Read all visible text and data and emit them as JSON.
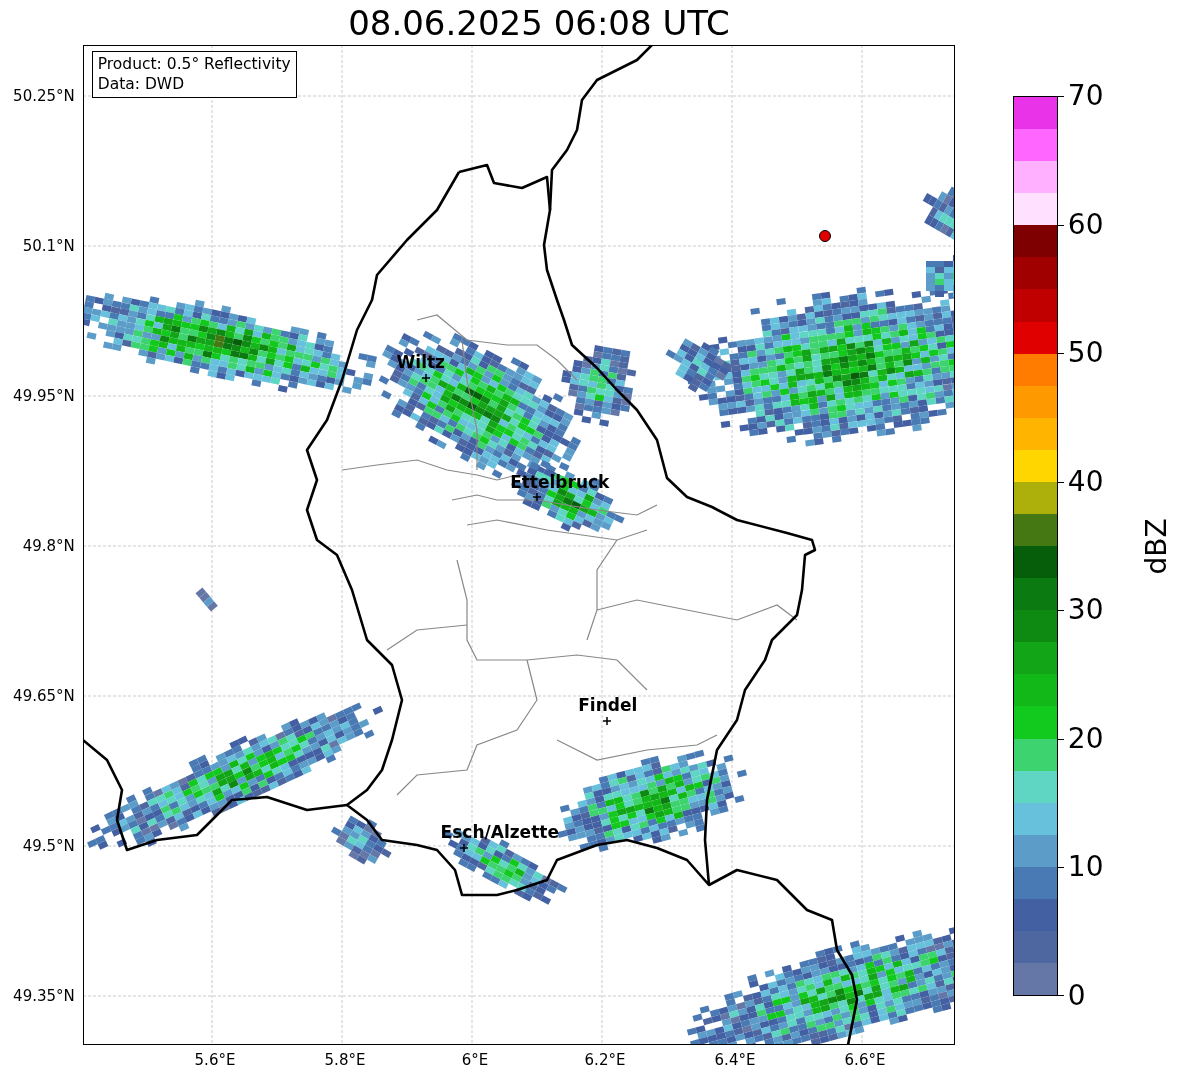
{
  "title": "08.06.2025 06:08 UTC",
  "info_box": [
    "Product: 0.5° Reflectivity",
    "Data: DWD"
  ],
  "map": {
    "lat_ticks": [
      "50.25°N",
      "50.1°N",
      "49.95°N",
      "49.8°N",
      "49.65°N",
      "49.5°N",
      "49.35°N"
    ],
    "lon_ticks": [
      "5.6°E",
      "5.8°E",
      "6°E",
      "6.2°E",
      "6.4°E",
      "6.6°E"
    ],
    "places": [
      {
        "name": "Wiltz"
      },
      {
        "name": "Ettelbruck"
      },
      {
        "name": "Findel"
      },
      {
        "name": "Esch/Alzette"
      }
    ]
  },
  "colorbar": {
    "label": "dBZ",
    "ticks": [
      "70",
      "60",
      "50",
      "40",
      "30",
      "20",
      "10",
      "0"
    ],
    "levels": [
      {
        "color": "#e833e8"
      },
      {
        "color": "#ff66ff"
      },
      {
        "color": "#ffb0ff"
      },
      {
        "color": "#ffe0ff"
      },
      {
        "color": "#7e0000"
      },
      {
        "color": "#a00000"
      },
      {
        "color": "#c00000"
      },
      {
        "color": "#e10000"
      },
      {
        "color": "#ff7c00"
      },
      {
        "color": "#ff9900"
      },
      {
        "color": "#ffb400"
      },
      {
        "color": "#ffd600"
      },
      {
        "color": "#adb00a"
      },
      {
        "color": "#457812"
      },
      {
        "color": "#065e0b"
      },
      {
        "color": "#0b7a10"
      },
      {
        "color": "#0e8a12"
      },
      {
        "color": "#12a518"
      },
      {
        "color": "#12b818"
      },
      {
        "color": "#12c91e"
      },
      {
        "color": "#3dd36e"
      },
      {
        "color": "#5fd5c4"
      },
      {
        "color": "#67c1dc"
      },
      {
        "color": "#5b9dc8"
      },
      {
        "color": "#4a7ab3"
      },
      {
        "color": "#4360a3"
      },
      {
        "color": "#4f67a0"
      },
      {
        "color": "#6577a6"
      }
    ]
  }
}
